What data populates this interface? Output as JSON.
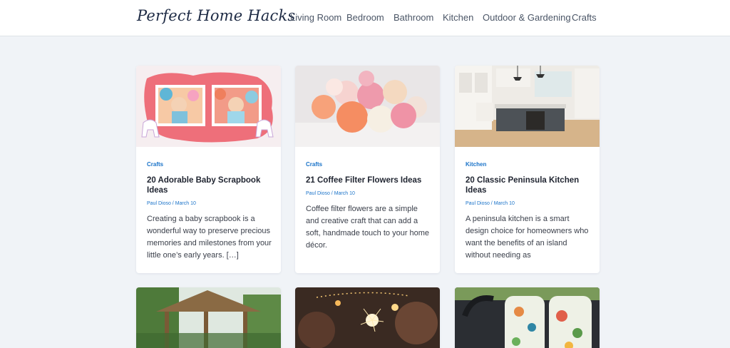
{
  "site": {
    "logo": "Perfect Home Hacks"
  },
  "nav": [
    {
      "label": "Living Room"
    },
    {
      "label": "Bedroom"
    },
    {
      "label": "Bathroom"
    },
    {
      "label": "Kitchen"
    },
    {
      "label": "Outdoor & Gardening"
    },
    {
      "label": "Crafts"
    }
  ],
  "posts": [
    {
      "category": "Crafts",
      "title": "20 Adorable Baby Scrapbook Ideas",
      "author": "Paul Dioso",
      "date": "March 10",
      "excerpt": "Creating a baby scrapbook is a wonderful way to preserve precious memories and milestones from your little one’s early years. […]"
    },
    {
      "category": "Crafts",
      "title": "21 Coffee Filter Flowers Ideas",
      "author": "Paul Dioso",
      "date": "March 10",
      "excerpt": "Coffee filter flowers are a simple and creative craft that can add a soft, handmade touch to your home décor."
    },
    {
      "category": "Kitchen",
      "title": "20 Classic Peninsula Kitchen Ideas",
      "author": "Paul Dioso",
      "date": "March 10",
      "excerpt": "A peninsula kitchen is a smart design choice for homeowners who want the benefits of an island without needing as"
    }
  ],
  "meta_separator": " / "
}
